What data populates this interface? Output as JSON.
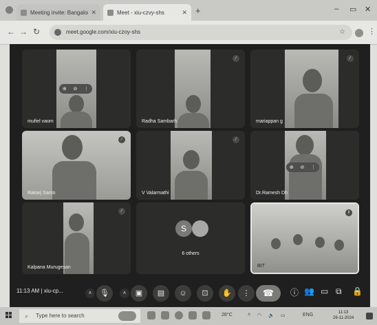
{
  "browser": {
    "tabs": [
      {
        "label": "Meeting invite: Bangalore Inst",
        "active": false
      },
      {
        "label": "Meet - xiu-czvy-shs",
        "active": true
      }
    ],
    "address": "meet.google.com/xiu-czoy-shs"
  },
  "meet": {
    "tiles": [
      {
        "name": "mufiel vaom"
      },
      {
        "name": "Radha Sambarh"
      },
      {
        "name": "mariappan g"
      },
      {
        "name": "Rakarj Santo"
      },
      {
        "name": "V Valarmathi"
      },
      {
        "name": "Dr.Ramesh Dh"
      },
      {
        "name": "Kalpana Murugesan"
      },
      {
        "name": "6 others"
      },
      {
        "name": "BIT"
      }
    ],
    "others": {
      "avatar_letter": "S",
      "label": "6 others"
    },
    "time": "11:13 AM",
    "meeting_code": "xiu-cp..."
  },
  "taskbar": {
    "search_placeholder": "Type here to search",
    "tray_text": "28°C",
    "lang": "ENG",
    "clock_time": "11:13",
    "clock_date": "26-11-2024"
  },
  "icons": {
    "mic": "🎙",
    "camera": "▢",
    "raise_hand": "✋",
    "end_call": "☎"
  }
}
